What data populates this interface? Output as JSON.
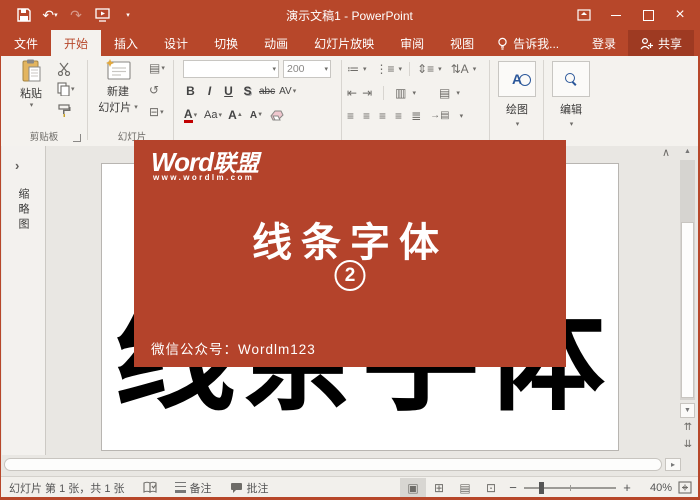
{
  "titlebar": {
    "title": "演示文稿1 - PowerPoint"
  },
  "tabs": {
    "file": "文件",
    "home": "开始",
    "insert": "插入",
    "design": "设计",
    "transitions": "切换",
    "animations": "动画",
    "slideshow": "幻灯片放映",
    "review": "审阅",
    "view": "视图",
    "tellme": "告诉我...",
    "signin": "登录",
    "share": "共享"
  },
  "ribbon": {
    "paste": "粘贴",
    "clipboard_group": "剪贴板",
    "new_slide_line1": "新建",
    "new_slide_line2": "幻灯片",
    "slides_group": "幻灯片",
    "font_name": "",
    "font_size": "200",
    "bold": "B",
    "italic": "I",
    "underline": "U",
    "shadow": "S",
    "strikethrough": "abc",
    "char_spacing": "AV",
    "font_color": "A",
    "change_case": "Aa",
    "grow_font": "A",
    "shrink_font": "A",
    "drawing": "绘图",
    "editing": "编辑"
  },
  "sidebar": {
    "thumbnails_label": "缩略图"
  },
  "slide": {
    "big_text": "线条字体"
  },
  "overlay": {
    "logo_en": "Word",
    "logo_cn": "联盟",
    "logo_url": "www.wordlm.com",
    "title": "线条字体",
    "number": "2",
    "footer": "微信公众号：Wordlm123"
  },
  "statusbar": {
    "slide_counter": "幻灯片 第 1 张，共 1 张",
    "notes": "备注",
    "comments": "批注",
    "zoom_minus": "−",
    "zoom_plus": "+",
    "zoom_level": "40%"
  },
  "icons": {
    "undo": "↶",
    "redo": "↷",
    "qat_more": "▾",
    "dropdown": "▾",
    "close": "×",
    "chevron_right": "›",
    "collapse_ribbon": "∧",
    "scroll_up": "▲",
    "scroll_down": "▼",
    "scroll_right": "▸",
    "prev_slide": "⇈",
    "next_slide": "⇊",
    "bullets": "≔",
    "numbering": "⋮≡",
    "line_spacing": "⇕≡",
    "text_direction": "⇅A",
    "indent_decrease": "⇤",
    "indent_increase": "⇥",
    "columns": "▥",
    "align_text": "▤",
    "align_left": "≡",
    "align_center": "≡",
    "align_right": "≡",
    "justify": "≡",
    "distribute": "≣",
    "smartart": "→▤",
    "layout": "▤",
    "reset": "↺",
    "section": "⊟",
    "view_normal": "▣",
    "view_sorter": "⊞",
    "view_reading": "▤",
    "view_slideshow": "⊡"
  },
  "colors": {
    "brand_red": "#B7472A",
    "card_red": "#B4432B",
    "share_button_bg": "#9E3A22",
    "selected_gray": "#D8D6D2"
  }
}
